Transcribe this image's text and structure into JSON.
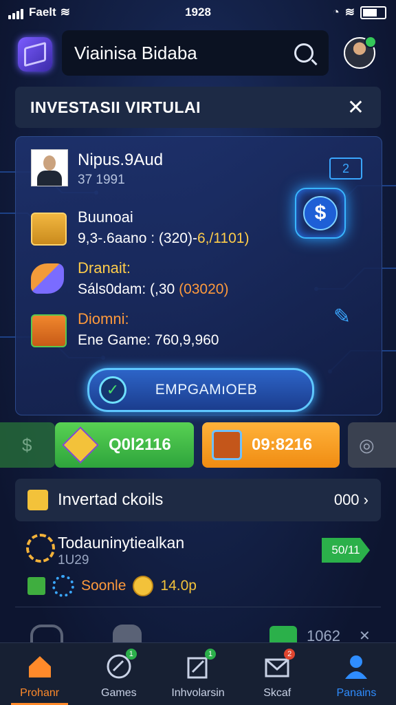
{
  "status": {
    "carrier": "Faelt",
    "time": "1928"
  },
  "header": {
    "title": "Viainisa Bidaba",
    "logo_icon": "cube-logo-icon",
    "search_icon": "search-icon"
  },
  "titlebar": {
    "title": "INVESTASII VIRTULAI",
    "close": "✕"
  },
  "profile": {
    "name": "Nipus.9Aud",
    "sub": "37    1991",
    "badge": "2"
  },
  "rows": [
    {
      "label": "Buunoai",
      "value_prefix": "9,3-.6aano : (320)-",
      "value_highlight": "6,/1101)",
      "label_color": "#ffffff"
    },
    {
      "label": "Dranait:",
      "value_prefix": "Sáls0dam: (,30 ",
      "value_highlight": "(03020)",
      "label_color": "#ffcd4a"
    },
    {
      "label": "Diomni:",
      "value_prefix": "Ene Game: 760,9,960",
      "value_highlight": "",
      "label_color": "#ff9a3c"
    }
  ],
  "cta": {
    "label": "EMPGAMıOEB"
  },
  "stats": {
    "green_value": "Q0l2116",
    "orange_value": "09:8216"
  },
  "list": {
    "title": "Invertad ckoils",
    "more": "000",
    "item": {
      "title": "Todauninytiealkan",
      "sub": "1U29",
      "tag": "50/11",
      "reward_label": "Soonle",
      "reward_value": "14.0p"
    },
    "peek_value": "1062"
  },
  "nav": [
    {
      "label": "Prohanr",
      "icon": "home-icon"
    },
    {
      "label": "Games",
      "icon": "games-icon",
      "badge": "1"
    },
    {
      "label": "Inhvolarsin",
      "icon": "investment-icon",
      "badge": "1"
    },
    {
      "label": "Skcaf",
      "icon": "mail-icon",
      "badge": "2"
    },
    {
      "label": "Panains",
      "icon": "profile-icon"
    }
  ],
  "colors": {
    "accent_orange": "#ff8a2a",
    "accent_blue": "#2f8dff",
    "green": "#34c759"
  }
}
